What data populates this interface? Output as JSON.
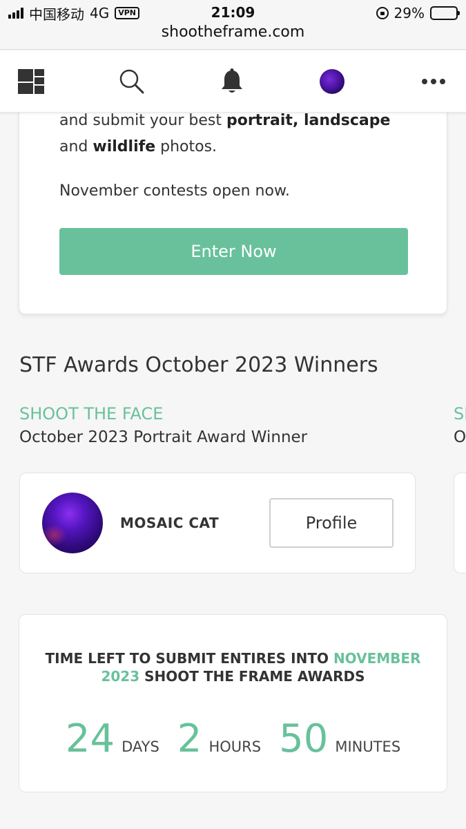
{
  "status_bar": {
    "carrier": "中国移动",
    "network": "4G",
    "vpn": "VPN",
    "time": "21:09",
    "battery": "29%",
    "battery_level": 0.29,
    "url": "shootheframe.com"
  },
  "nav": {
    "icons": [
      "grid-logo-icon",
      "search-icon",
      "bell-icon",
      "avatar",
      "more-icon"
    ]
  },
  "promo": {
    "line1_pre": "and submit your best ",
    "line1_bold": "portrait, landscape",
    "line2_pre": "and ",
    "line2_bold": "wildlife",
    "line2_post": " photos.",
    "line3": "November contests open now.",
    "button": "Enter Now"
  },
  "winners": {
    "title": "STF Awards October 2023 Winners",
    "categories": [
      {
        "name": "SHOOT THE FACE",
        "subtitle": "October 2023 Portrait Award Winner",
        "winner": "MOSAIC CAT",
        "button": "Profile"
      },
      {
        "name": "SI",
        "subtitle": "O"
      }
    ]
  },
  "countdown": {
    "head_pre": "TIME LEFT TO SUBMIT ENTIRES INTO ",
    "head_accent": "NOVEMBER 2023",
    "head_post": " SHOOT THE FRAME AWARDS",
    "days": "24",
    "days_label": "DAYS",
    "hours": "2",
    "hours_label": "HOURS",
    "minutes": "50",
    "minutes_label": "MINUTES"
  },
  "colors": {
    "accent": "#68c19b"
  }
}
